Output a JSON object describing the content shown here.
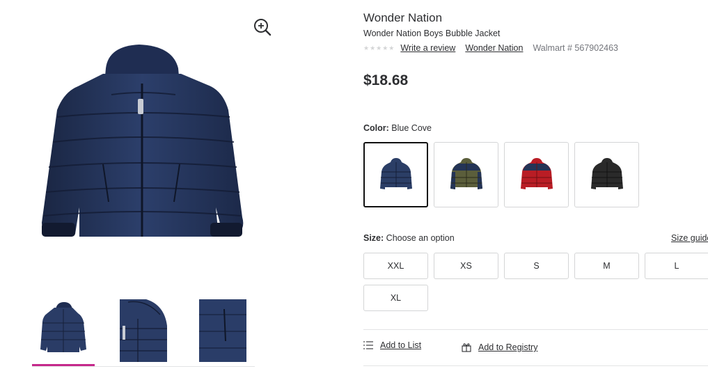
{
  "media": {
    "zoom_icon": "zoom-in-icon",
    "main_image_alt": "Wonder Nation Boys Bubble Jacket",
    "thumbnails": [
      "front-view",
      "hood-detail",
      "pocket-detail"
    ],
    "selected_thumbnail": 0
  },
  "product": {
    "brand": "Wonder Nation",
    "name": "Wonder Nation Boys Bubble Jacket",
    "rating_stars": "★★★★★",
    "write_review": "Write a review",
    "brand_link": "Wonder Nation",
    "item_number": "Walmart # 567902463",
    "price": "$18.68"
  },
  "color": {
    "label": "Color:",
    "selected_value": "Blue Cove",
    "swatches": [
      {
        "name": "blue-cove",
        "body": "#2b3e66"
      },
      {
        "name": "olive-navy",
        "body": "#5b5e3b"
      },
      {
        "name": "red",
        "body": "#b91d25"
      },
      {
        "name": "black",
        "body": "#2a2a2a"
      }
    ]
  },
  "size": {
    "label": "Size:",
    "value": "Choose an option",
    "guide": "Size guide",
    "options": [
      "XXL",
      "XS",
      "S",
      "M",
      "L",
      "XL"
    ]
  },
  "actions": {
    "add_to_list": "Add to List",
    "add_to_registry": "Add to Registry"
  },
  "colors": {
    "accent_underline": "#c5288b",
    "text": "#2e2f32",
    "muted": "#74767c",
    "border": "#d4d5d6"
  }
}
